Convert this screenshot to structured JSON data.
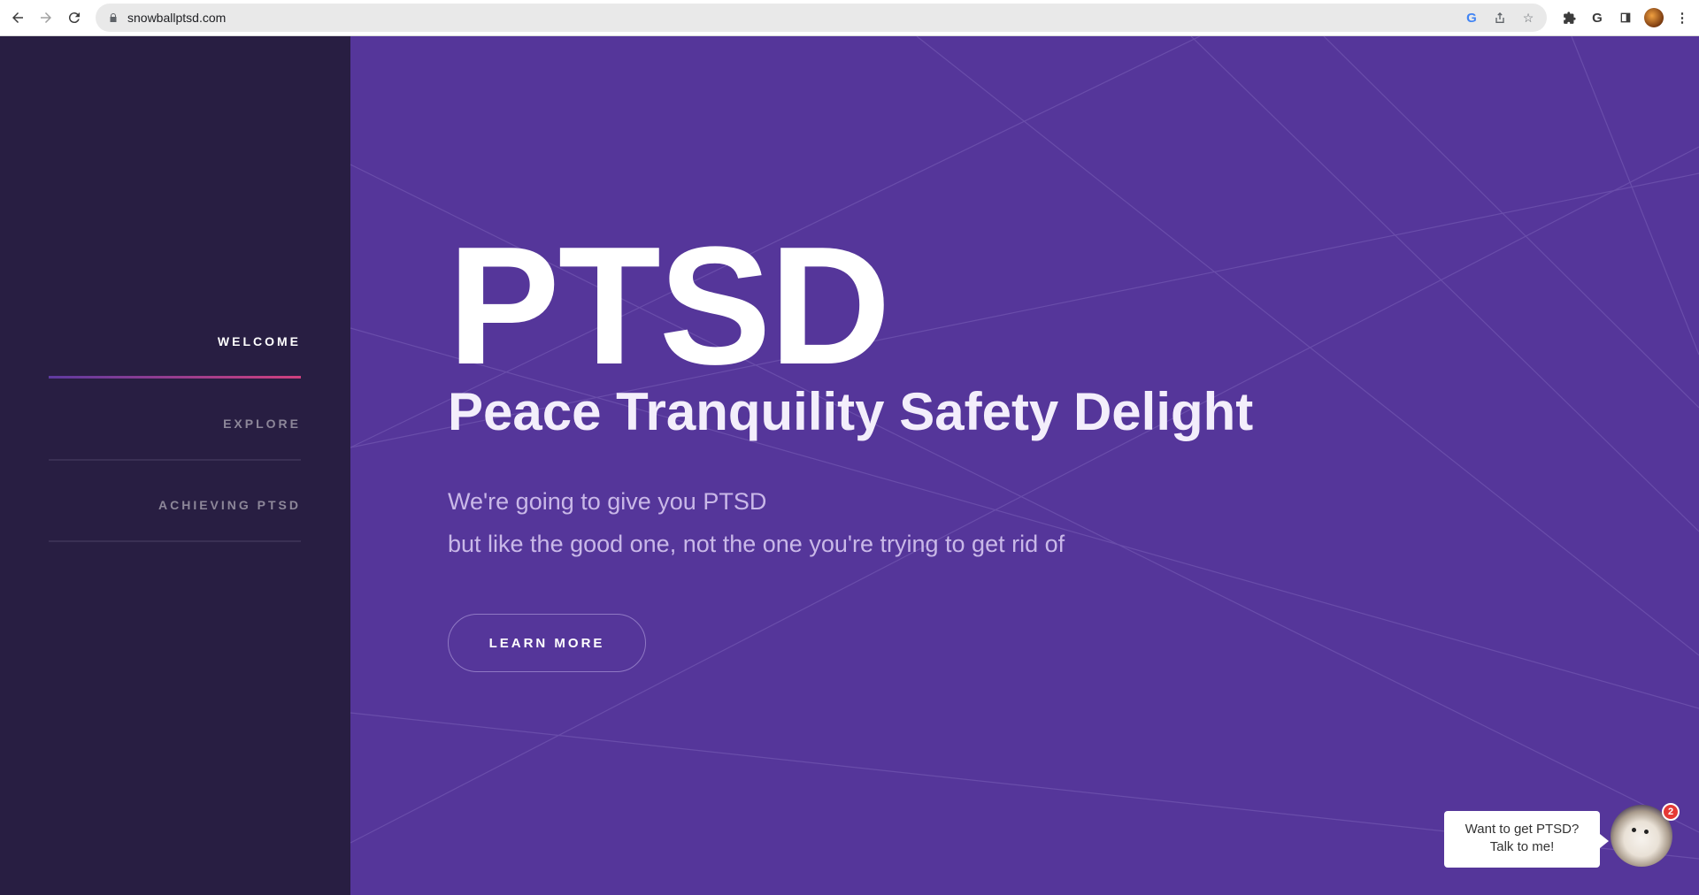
{
  "browser": {
    "url": "snowballptsd.com",
    "profile_initial": ""
  },
  "sidebar": {
    "items": [
      {
        "label": "WELCOME",
        "active": true
      },
      {
        "label": "EXPLORE",
        "active": false
      },
      {
        "label": "ACHIEVING PTSD",
        "active": false
      }
    ]
  },
  "hero": {
    "title": "PTSD",
    "subtitle": "Peace Tranquility Safety Delight",
    "description_line1": "We're going to give you PTSD",
    "description_line2": "but like the good one, not the one you're trying to get rid of",
    "button_label": "LEARN MORE"
  },
  "chat": {
    "message": "Want to get PTSD? Talk to me!",
    "badge_count": "2"
  },
  "colors": {
    "sidebar_bg": "#281e42",
    "main_bg": "#55369a",
    "accent_gradient_start": "#5e3aa0",
    "accent_gradient_end": "#d0407e",
    "badge": "#e53935"
  }
}
